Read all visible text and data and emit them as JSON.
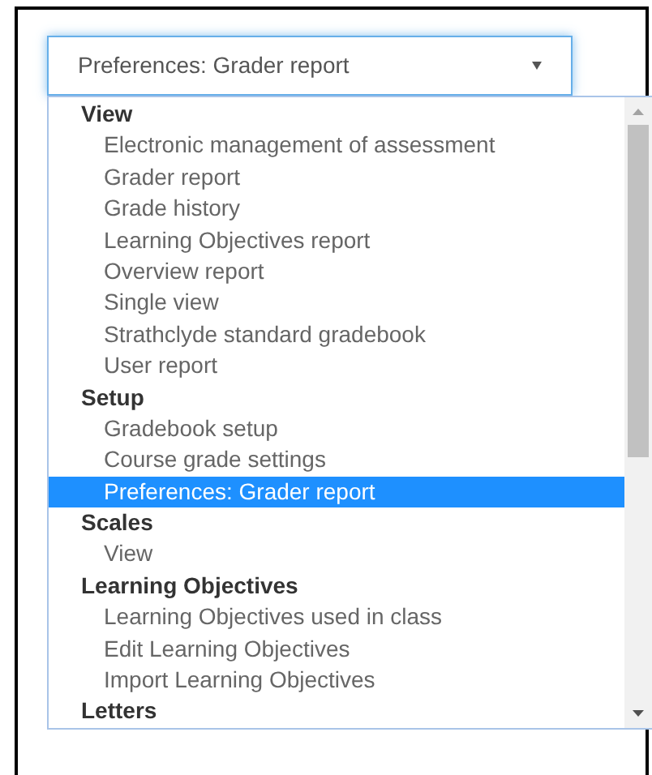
{
  "select": {
    "value": "Preferences: Grader report"
  },
  "groups": [
    {
      "label": "View",
      "items": [
        {
          "label": "Electronic management of assessment",
          "selected": false
        },
        {
          "label": "Grader report",
          "selected": false
        },
        {
          "label": "Grade history",
          "selected": false
        },
        {
          "label": "Learning Objectives report",
          "selected": false
        },
        {
          "label": "Overview report",
          "selected": false
        },
        {
          "label": "Single view",
          "selected": false
        },
        {
          "label": "Strathclyde standard gradebook",
          "selected": false
        },
        {
          "label": "User report",
          "selected": false
        }
      ]
    },
    {
      "label": "Setup",
      "items": [
        {
          "label": "Gradebook setup",
          "selected": false
        },
        {
          "label": "Course grade settings",
          "selected": false
        },
        {
          "label": "Preferences: Grader report",
          "selected": true
        }
      ]
    },
    {
      "label": "Scales",
      "items": [
        {
          "label": "View",
          "selected": false
        }
      ]
    },
    {
      "label": "Learning Objectives",
      "items": [
        {
          "label": "Learning Objectives used in class",
          "selected": false
        },
        {
          "label": "Edit Learning Objectives",
          "selected": false
        },
        {
          "label": "Import Learning Objectives",
          "selected": false
        }
      ]
    },
    {
      "label": "Letters"
    }
  ]
}
